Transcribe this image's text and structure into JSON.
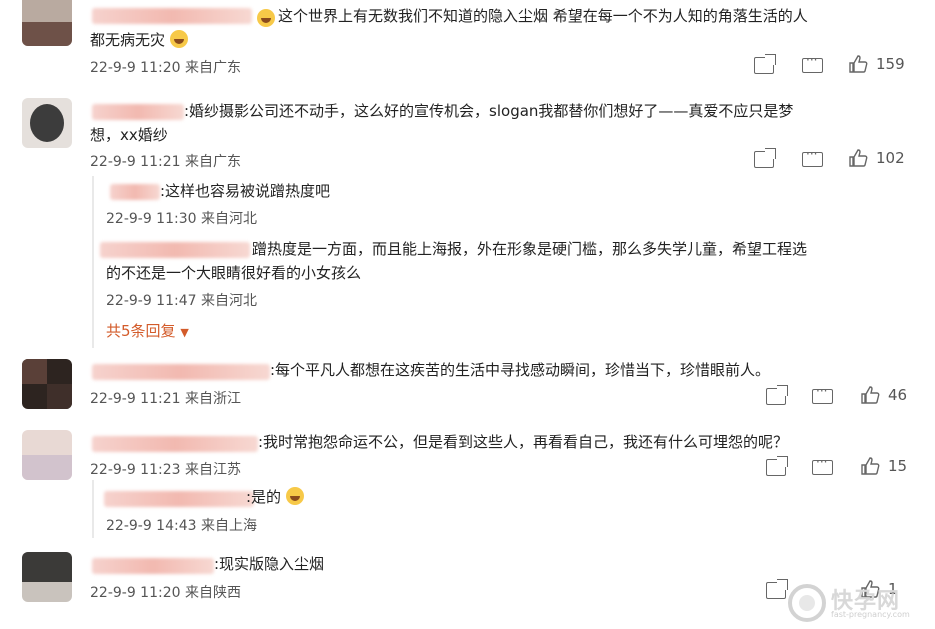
{
  "comments": [
    {
      "text": "这个世界上有无数我们不知道的隐入尘烟 希望在每一个不为人知的角落生活的人都无病无灾",
      "line1": "这个世界上有无数我们不知道的隐入尘烟 希望在每一个不为人知的角落生活的人",
      "line2": "都无病无灾",
      "time": "22-9-9 11:20 来自广东",
      "likes": "159"
    },
    {
      "name_partial": "胡知er战纪",
      "line1": ":婚纱摄影公司还不动手，这么好的宣传机会，slogan我都替你们想好了——真爱不应只是梦",
      "line2": "想，xx婚纱",
      "time": "22-9-9 11:21 来自广东",
      "likes": "102",
      "replies": [
        {
          "text": ":这样也容易被说蹭热度吧",
          "time": "22-9-9 11:30 来自河北"
        },
        {
          "line1": "蹭热度是一方面，而且能上海报，外在形象是硬门槛，那么多失学儿童，希望工程选",
          "line2": "的不还是一个大眼睛很好看的小女孩么",
          "time": "22-9-9 11:47 来自河北"
        }
      ],
      "expand": "共5条回复"
    },
    {
      "text": ":每个平凡人都想在这疾苦的生活中寻找感动瞬间，珍惜当下，珍惜眼前人。",
      "time": "22-9-9 11:21 来自浙江",
      "likes": "46"
    },
    {
      "text": ":我时常抱怨命运不公，但是看到这些人，再看看自己，我还有什么可埋怨的呢？",
      "time": "22-9-9 11:23 来自江苏",
      "likes": "15",
      "reply": {
        "name_partial": "樱桃小可爱子",
        "text": ":是的",
        "time": "22-9-9 14:43 来自上海"
      }
    },
    {
      "text": ":现实版隐入尘烟",
      "time": "22-9-9 11:20 来自陕西",
      "likes": "1"
    }
  ],
  "colors": {
    "expand": "#d35b2a",
    "meta": "#555555",
    "border": "#e9e9e9"
  },
  "icons": [
    "share-icon",
    "comment-icon",
    "like-icon"
  ],
  "watermark": {
    "main": "快孕网",
    "sub": "fast-pregnancy.com"
  }
}
